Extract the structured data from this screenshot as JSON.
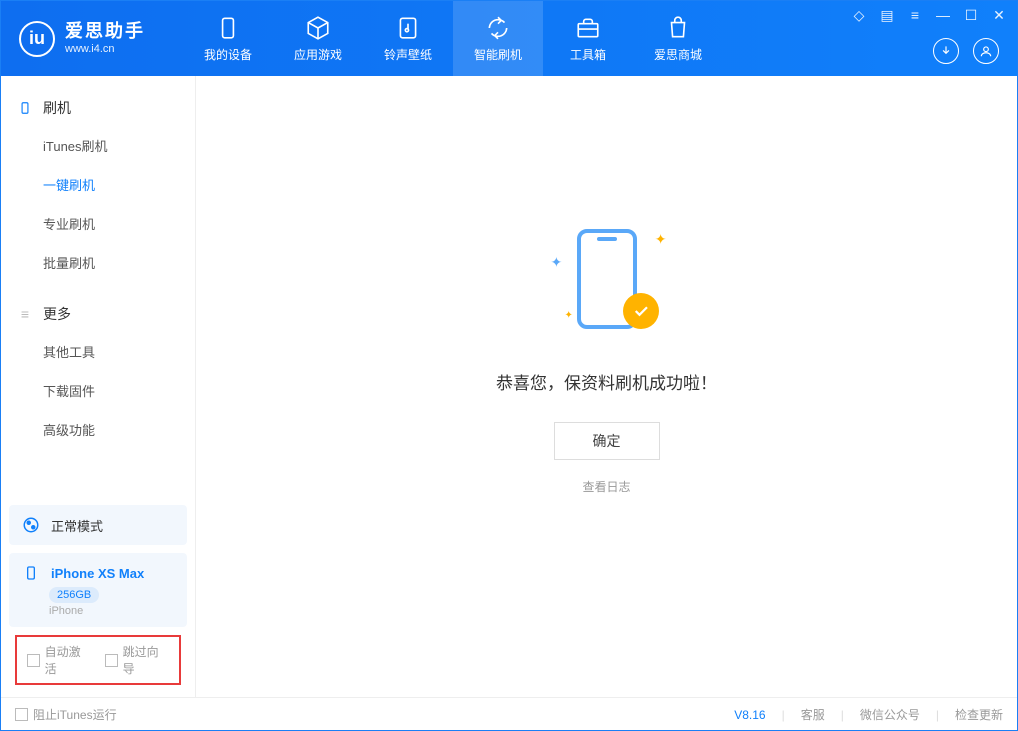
{
  "app": {
    "name": "爱思助手",
    "url": "www.i4.cn",
    "logo_letter": "iu"
  },
  "nav": [
    {
      "label": "我的设备",
      "icon": "device"
    },
    {
      "label": "应用游戏",
      "icon": "cube"
    },
    {
      "label": "铃声壁纸",
      "icon": "music"
    },
    {
      "label": "智能刷机",
      "icon": "refresh",
      "active": true
    },
    {
      "label": "工具箱",
      "icon": "toolbox"
    },
    {
      "label": "爱思商城",
      "icon": "shop"
    }
  ],
  "sidebar": {
    "section1": {
      "title": "刷机",
      "items": [
        "iTunes刷机",
        "一键刷机",
        "专业刷机",
        "批量刷机"
      ],
      "active_index": 1
    },
    "section2": {
      "title": "更多",
      "items": [
        "其他工具",
        "下载固件",
        "高级功能"
      ]
    }
  },
  "device_status": {
    "mode_label": "正常模式",
    "device_name": "iPhone XS Max",
    "storage": "256GB",
    "platform": "iPhone"
  },
  "options": {
    "auto_activate": "自动激活",
    "skip_guide": "跳过向导"
  },
  "main": {
    "success_text": "恭喜您，保资料刷机成功啦！",
    "ok_button": "确定",
    "view_log": "查看日志"
  },
  "footer": {
    "block_itunes": "阻止iTunes运行",
    "version": "V8.16",
    "links": [
      "客服",
      "微信公众号",
      "检查更新"
    ]
  }
}
